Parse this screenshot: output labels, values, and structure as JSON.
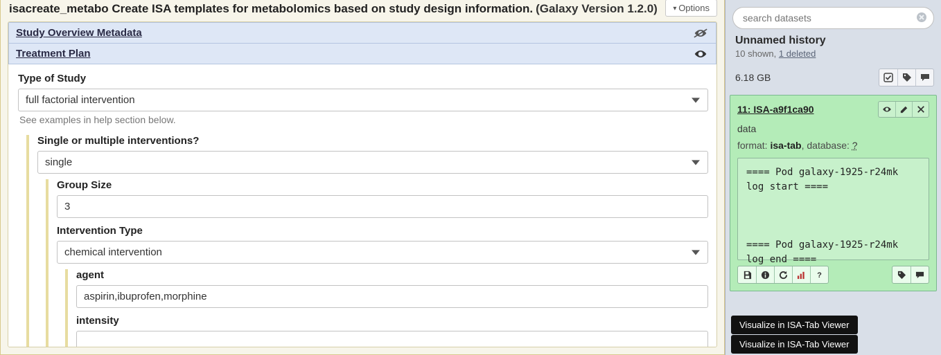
{
  "tool": {
    "header_prefix": "isacreate_metabo Create ISA templates for metabolomics based on study design information.",
    "version": "(Galaxy Version 1.2.0)",
    "options_label": "Options"
  },
  "sections": {
    "overview": {
      "title": "Study Overview Metadata",
      "visible": false
    },
    "treatment": {
      "title": "Treatment Plan",
      "visible": true
    }
  },
  "fields": {
    "type_of_study": {
      "label": "Type of Study",
      "value": "full factorial intervention",
      "help": "See examples in help section below."
    },
    "interventions": {
      "label": "Single or multiple interventions?",
      "value": "single"
    },
    "group_size": {
      "label": "Group Size",
      "value": "3"
    },
    "intervention_type": {
      "label": "Intervention Type",
      "value": "chemical intervention"
    },
    "agent": {
      "label": "agent",
      "value": "aspirin,ibuprofen,morphine"
    },
    "intensity": {
      "label": "intensity",
      "value": ""
    }
  },
  "history": {
    "search_placeholder": "search datasets",
    "title": "Unnamed history",
    "shown": "10 shown, ",
    "deleted": "1 deleted",
    "size": "6.18 GB"
  },
  "dataset": {
    "name": "11: ISA-a9f1ca90 ",
    "data_label": "data",
    "format_label": "format: ",
    "format_value": "isa-tab",
    "db_label": ", database: ",
    "db_value": "?",
    "log": "==== Pod galaxy-1925-r24mk log start ====\n\n\n\n==== Pod galaxy-1925-r24mk log end ===="
  },
  "tooltip": {
    "text1": "Visualize in ISA-Tab Viewer",
    "text2": "Visualize in ISA-Tab Viewer"
  }
}
